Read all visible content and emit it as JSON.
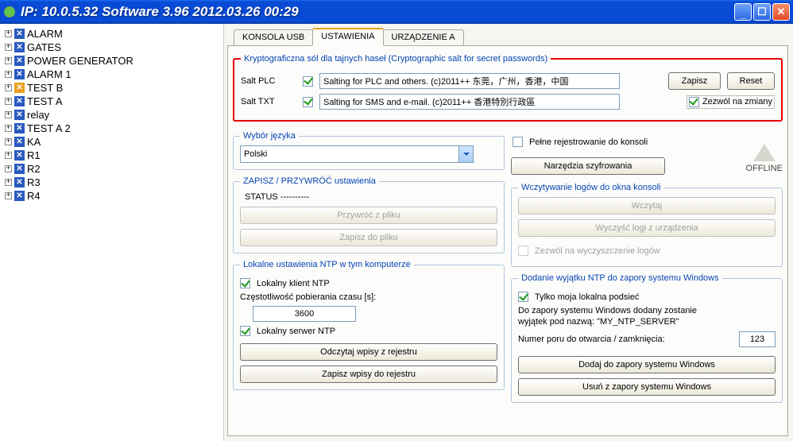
{
  "title": "IP: 10.0.5.32   Software 3.96  2012.03.26  00:29",
  "tree": [
    {
      "label": "ALARM",
      "icon": "blue"
    },
    {
      "label": "GATES",
      "icon": "blue"
    },
    {
      "label": "POWER GENERATOR",
      "icon": "blue"
    },
    {
      "label": "ALARM 1",
      "icon": "blue"
    },
    {
      "label": "TEST B",
      "icon": "orange"
    },
    {
      "label": "TEST A",
      "icon": "blue"
    },
    {
      "label": "relay",
      "icon": "blue"
    },
    {
      "label": "TEST A 2",
      "icon": "blue"
    },
    {
      "label": "KA",
      "icon": "blue"
    },
    {
      "label": "R1",
      "icon": "blue"
    },
    {
      "label": "R2",
      "icon": "blue"
    },
    {
      "label": "R3",
      "icon": "blue"
    },
    {
      "label": "R4",
      "icon": "blue"
    }
  ],
  "tabs": {
    "usb": "KONSOLA USB",
    "settings": "USTAWIENIA",
    "device": "URZĄDZENIE A"
  },
  "crypto": {
    "legend": "Kryptograficzna sól dla tajnych haseł (Cryptographic salt for secret passwords)",
    "plc_label": "Salt PLC",
    "plc_value": "Salting for PLC and others. (c)2011++ 东莞，广州，香港，中国",
    "txt_label": "Salt TXT",
    "txt_value": "Salting for SMS and e-mail. (c)2011++ 香港特別行政區",
    "save": "Zapisz",
    "reset": "Reset",
    "allow": "Zezwól na zmiany"
  },
  "lang": {
    "legend": "Wybór języka",
    "value": "Polski"
  },
  "saverestore": {
    "legend": "ZAPISZ / PRZYWRÓĆ ustawienia",
    "status": "STATUS ----------",
    "restore": "Przywróć z pliku",
    "save": "Zapisz do pliku"
  },
  "right_top": {
    "fulllog": "Pełne rejestrowanie do konsoli",
    "tools": "Narzędzia szyfrowania",
    "offline": "OFFLINE"
  },
  "logs": {
    "legend": "Wczytywanie logów do okna konsoli",
    "load": "Wczytaj",
    "clear": "Wyczyść logi z urządzenia",
    "allow": "Zezwól na wyczyszczenie logów"
  },
  "ntp_local": {
    "legend": "Lokalne ustawienia NTP w tym komputerze",
    "client": "Lokalny klient NTP",
    "freq_label": "Częstotliwość pobierania czasu [s]:",
    "freq_value": "3600",
    "server": "Lokalny serwer NTP",
    "read": "Odczytaj wpisy z rejestru",
    "write": "Zapisz wpisy do rejestru"
  },
  "ntp_fw": {
    "legend": "Dodanie wyjątku NTP do zapory systemu Windows",
    "only_local": "Tylko moja lokalna podsieć",
    "desc1": "Do zapory systemu Windows dodany zostanie",
    "desc2": "wyjątek pod nazwą: \"MY_NTP_SERVER\"",
    "port_label": "Numer poru do otwarcia / zamknięcia:",
    "port_value": "123",
    "add": "Dodaj do zapory systemu Windows",
    "del": "Usuń z zapory systemu Windows"
  }
}
